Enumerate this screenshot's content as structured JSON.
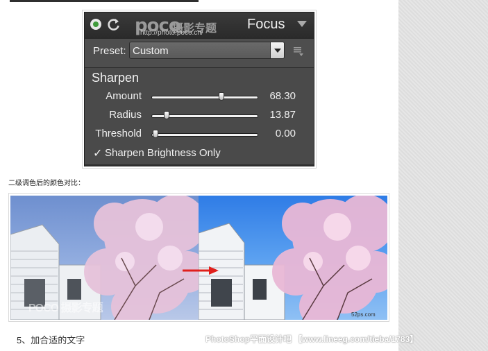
{
  "panel": {
    "logo_word": "poco",
    "logo_cn": "摄影专题",
    "logo_url": "http://photo.poco.cn/",
    "title": "Focus",
    "preset_label": "Preset:",
    "preset_value": "Custom",
    "section_title": "Sharpen",
    "sliders": [
      {
        "label": "Amount",
        "value": "68.30",
        "position": 0.66
      },
      {
        "label": "Radius",
        "value": "13.87",
        "position": 0.14
      },
      {
        "label": "Threshold",
        "value": "0.00",
        "position": 0.03
      }
    ],
    "checkbox": {
      "checked": true,
      "mark": "✓",
      "label": "Sharpen Brightness Only"
    }
  },
  "caption": "二级调色后的颜色对比：",
  "comparison": {
    "watermark_left": "POCO 摄影专题",
    "watermark_right": "52ps.com"
  },
  "step_title": "5、加合适的文字",
  "footer_watermark": "PhotoShop平面设计吧 【www.lineeg.com/tieba/1783】",
  "colors": {
    "panel_bg": "#4a4a4a",
    "panel_header": "#2f2f2f",
    "arrow_red": "#e0201c",
    "sky_before": "#7e9dd6",
    "sky_after": "#3b86ea"
  },
  "icons": {
    "power": "power-icon",
    "refresh": "refresh-icon",
    "collapse": "triangle-down-icon",
    "menu": "list-menu-icon"
  }
}
